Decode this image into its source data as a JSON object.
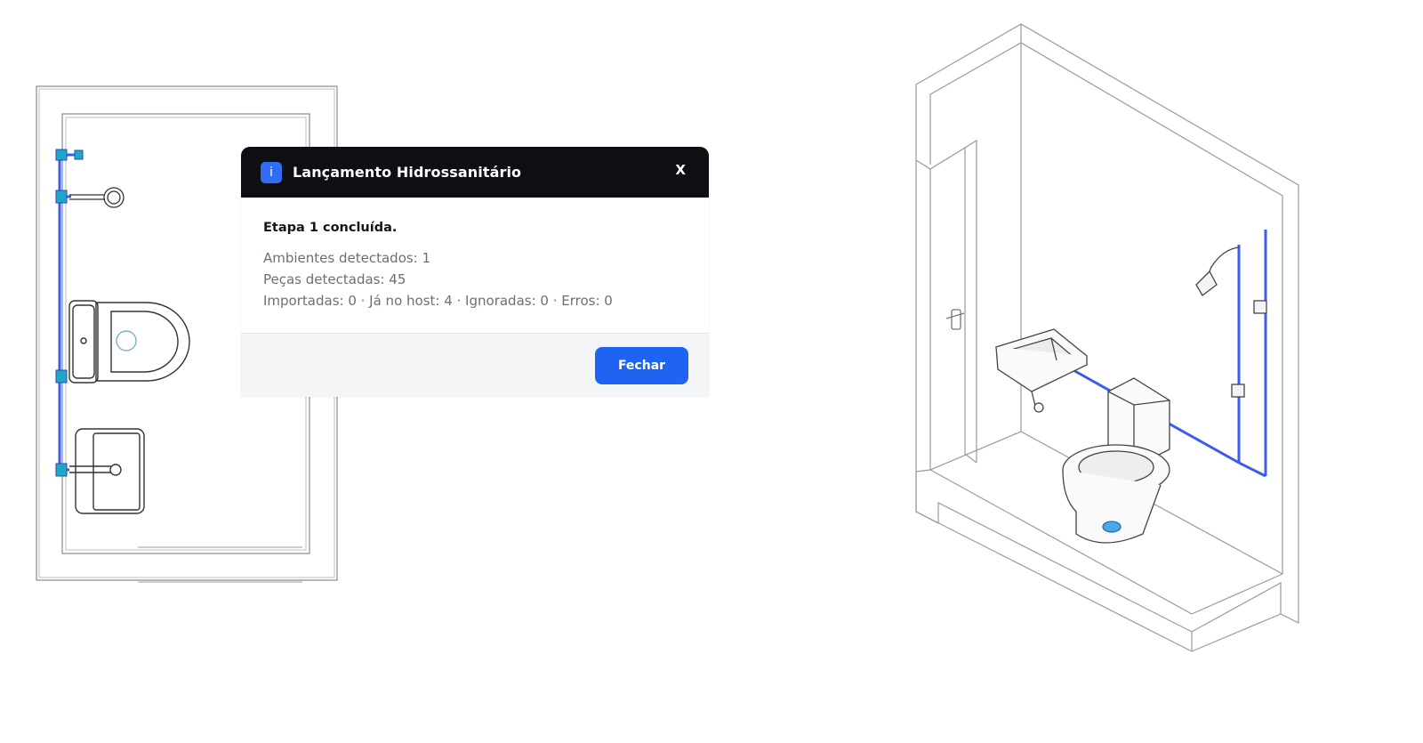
{
  "dialog": {
    "icon": "info-icon",
    "icon_glyph": "i",
    "title": "Lançamento Hidrossanitário",
    "close_label": "X",
    "heading": "Etapa 1 concluída.",
    "lines": [
      "Ambientes detectados: 1",
      "Peças detectadas: 45",
      "Importadas: 0 · Já no host: 4 · Ignoradas: 0 · Erros: 0"
    ],
    "button_label": "Fechar"
  },
  "colors": {
    "header_bg": "#0d0f12",
    "accent": "#1f63f3",
    "pipe": "#3a5cf0",
    "footer_bg": "#f4f5f7"
  }
}
